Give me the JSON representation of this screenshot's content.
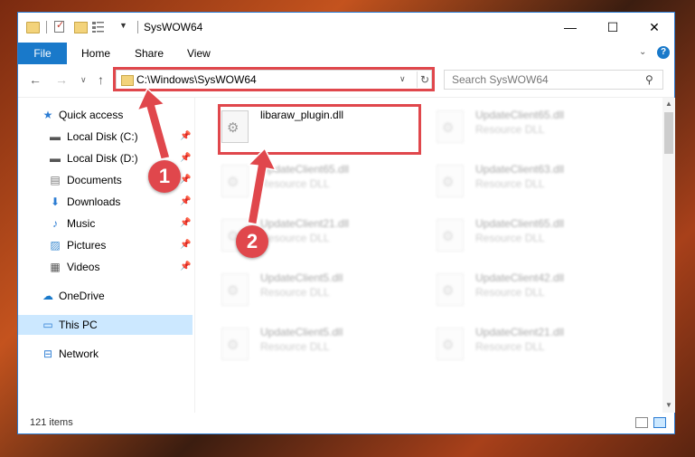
{
  "window": {
    "title": "SysWOW64",
    "controls": {
      "minimize": "—",
      "maximize": "☐",
      "close": "✕"
    }
  },
  "ribbon": {
    "tabs": [
      "File",
      "Home",
      "Share",
      "View"
    ],
    "help": "?"
  },
  "address_bar": {
    "path": "C:\\Windows\\SysWOW64"
  },
  "search": {
    "placeholder": "Search SysWOW64"
  },
  "sidebar": {
    "items": [
      {
        "label": "Quick access",
        "icon": "star-icon",
        "pinned": false
      },
      {
        "label": "Local Disk (C:)",
        "icon": "drive-icon",
        "pinned": true
      },
      {
        "label": "Local Disk (D:)",
        "icon": "drive-icon",
        "pinned": true
      },
      {
        "label": "Documents",
        "icon": "documents-icon",
        "pinned": true
      },
      {
        "label": "Downloads",
        "icon": "downloads-icon",
        "pinned": true
      },
      {
        "label": "Music",
        "icon": "music-icon",
        "pinned": true
      },
      {
        "label": "Pictures",
        "icon": "pictures-icon",
        "pinned": true
      },
      {
        "label": "Videos",
        "icon": "videos-icon",
        "pinned": true
      },
      {
        "label": "OneDrive",
        "icon": "cloud-icon",
        "pinned": false
      },
      {
        "label": "This PC",
        "icon": "computer-icon",
        "pinned": false,
        "selected": true
      },
      {
        "label": "Network",
        "icon": "network-icon",
        "pinned": false
      }
    ]
  },
  "files": [
    {
      "name": "libaraw_plugin.dll",
      "type": ""
    },
    {
      "name": "UpdateClient65.dll",
      "type": "Resource DLL"
    },
    {
      "name": "UpdateClient65.dll",
      "type": "Resource DLL"
    },
    {
      "name": "UpdateClient63.dll",
      "type": "Resource DLL"
    },
    {
      "name": "UpdateClient21.dll",
      "type": "Resource DLL"
    },
    {
      "name": "UpdateClient65.dll",
      "type": "Resource DLL"
    },
    {
      "name": "UpdateClient5.dll",
      "type": "Resource DLL"
    },
    {
      "name": "UpdateClient42.dll",
      "type": "Resource DLL"
    },
    {
      "name": "UpdateClient5.dll",
      "type": "Resource DLL"
    },
    {
      "name": "UpdateClient21.dll",
      "type": "Resource DLL"
    }
  ],
  "status": {
    "item_count": "121 items"
  },
  "annotations": {
    "step1": "1",
    "step2": "2",
    "color": "#e0474c"
  }
}
